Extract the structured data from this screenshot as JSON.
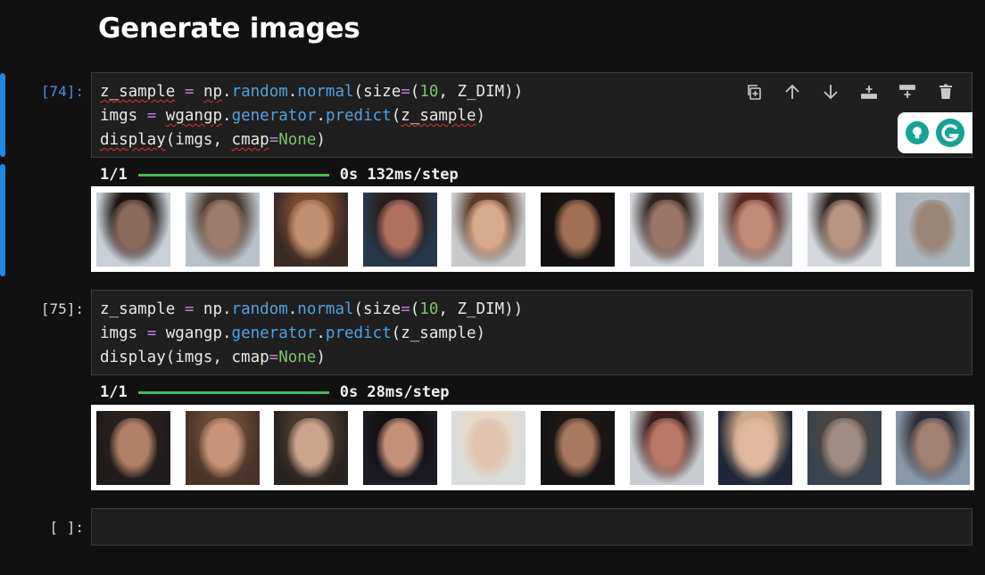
{
  "heading": "Generate images",
  "cells": [
    {
      "prompt": "[74]:",
      "code_lines": [
        [
          {
            "t": "z_sample",
            "c": "sq"
          },
          {
            "t": " "
          },
          {
            "t": "=",
            "c": "kw"
          },
          {
            "t": " "
          },
          {
            "t": "np",
            "c": "sq"
          },
          {
            "t": "."
          },
          {
            "t": "random",
            "c": "fn"
          },
          {
            "t": "."
          },
          {
            "t": "normal",
            "c": "fn"
          },
          {
            "t": "(size"
          },
          {
            "t": "=",
            "c": "kw"
          },
          {
            "t": "("
          },
          {
            "t": "10",
            "c": "nm"
          },
          {
            "t": ", Z_DIM))"
          }
        ],
        [
          {
            "t": "imgs"
          },
          {
            "t": " "
          },
          {
            "t": "=",
            "c": "kw"
          },
          {
            "t": " "
          },
          {
            "t": "wgangp",
            "c": "sq"
          },
          {
            "t": "."
          },
          {
            "t": "generator",
            "c": "fn"
          },
          {
            "t": "."
          },
          {
            "t": "predict",
            "c": "fn"
          },
          {
            "t": "("
          },
          {
            "t": "z_sample",
            "c": "sq"
          },
          {
            "t": ")"
          }
        ],
        [
          {
            "t": "display",
            "c": "sq"
          },
          {
            "t": "(imgs, "
          },
          {
            "t": "cmap",
            "c": "sq"
          },
          {
            "t": "=",
            "c": "kw"
          },
          {
            "t": "None",
            "c": "nm"
          },
          {
            "t": ")"
          }
        ]
      ],
      "progress": {
        "steps": "1/1",
        "timing": "0s 132ms/step",
        "fraction": 1.0
      }
    },
    {
      "prompt": "[75]:",
      "code_lines": [
        [
          {
            "t": "z_sample "
          },
          {
            "t": "=",
            "c": "kw"
          },
          {
            "t": " np."
          },
          {
            "t": "random",
            "c": "fn"
          },
          {
            "t": "."
          },
          {
            "t": "normal",
            "c": "fn"
          },
          {
            "t": "(size"
          },
          {
            "t": "=",
            "c": "kw"
          },
          {
            "t": "("
          },
          {
            "t": "10",
            "c": "nm"
          },
          {
            "t": ", Z_DIM))"
          }
        ],
        [
          {
            "t": "imgs "
          },
          {
            "t": "=",
            "c": "kw"
          },
          {
            "t": " wgangp."
          },
          {
            "t": "generator",
            "c": "fn"
          },
          {
            "t": "."
          },
          {
            "t": "predict",
            "c": "fn"
          },
          {
            "t": "(z_sample)"
          }
        ],
        [
          {
            "t": "display(imgs, cmap"
          },
          {
            "t": "=",
            "c": "kw"
          },
          {
            "t": "None",
            "c": "nm"
          },
          {
            "t": ")"
          }
        ]
      ],
      "progress": {
        "steps": "1/1",
        "timing": "0s 28ms/step",
        "fraction": 1.0
      }
    },
    {
      "prompt": "[ ]:"
    }
  ],
  "toolbar": {
    "buttons": [
      {
        "icon": "duplicate-icon",
        "label": "Duplicate cell"
      },
      {
        "icon": "arrow-up-icon",
        "label": "Move up"
      },
      {
        "icon": "arrow-down-icon",
        "label": "Move down"
      },
      {
        "icon": "insert-below-icon",
        "label": "Insert below"
      },
      {
        "icon": "insert-above-icon",
        "label": "Insert above"
      },
      {
        "icon": "trash-icon",
        "label": "Delete cell"
      }
    ]
  },
  "colors": {
    "prompt_active": "#4a8fd6",
    "prompt_inactive": "#d8d8d8",
    "accent": "#1e88e5",
    "progress": "#3cbf50"
  },
  "image_rows": [
    {
      "thumbnails": [
        {
          "bg": "#c8cfd6",
          "face": "#8a6a5a",
          "hair": "#1a1412"
        },
        {
          "bg": "#b8c0c8",
          "face": "#9c7d6c",
          "hair": "#4a3a30"
        },
        {
          "bg": "#3a2a24",
          "face": "#c09070",
          "hair": "#7a4a30"
        },
        {
          "bg": "#283848",
          "face": "#b07060",
          "hair": "#2a1e1a"
        },
        {
          "bg": "#c6c8ca",
          "face": "#d8aa8c",
          "hair": "#5a3a28"
        },
        {
          "bg": "#101010",
          "face": "#a07054",
          "hair": "#1a1210"
        },
        {
          "bg": "#d0d4d8",
          "face": "#9a7668",
          "hair": "#2e2420"
        },
        {
          "bg": "#b8bcc0",
          "face": "#c08a78",
          "hair": "#5a2a22"
        },
        {
          "bg": "#d4d8dc",
          "face": "#b89482",
          "hair": "#2a201c"
        },
        {
          "bg": "#a8b4bc",
          "face": "#9a8474",
          "hair": "#b0b8c0"
        }
      ]
    },
    {
      "thumbnails": [
        {
          "bg": "#201c1c",
          "face": "#b08068",
          "hair": "#2a201c"
        },
        {
          "bg": "#4a3428",
          "face": "#c89478",
          "hair": "#6a4a38"
        },
        {
          "bg": "#2a2420",
          "face": "#caa48c",
          "hair": "#4a3a30"
        },
        {
          "bg": "#1a1a24",
          "face": "#c4907a",
          "hair": "#141010"
        },
        {
          "bg": "#d8dcdc",
          "face": "#e0c4b0",
          "hair": "#e8d8c8"
        },
        {
          "bg": "#141414",
          "face": "#a87860",
          "hair": "#201814"
        },
        {
          "bg": "#c8ccd0",
          "face": "#b87868",
          "hair": "#3a1e1c"
        },
        {
          "bg": "#202838",
          "face": "#e0b8a0",
          "hair": "#cca888"
        },
        {
          "bg": "#3a4450",
          "face": "#a08c80",
          "hair": "#4a4440"
        },
        {
          "bg": "#8898a8",
          "face": "#a08070",
          "hair": "#2c2c38"
        }
      ]
    }
  ]
}
